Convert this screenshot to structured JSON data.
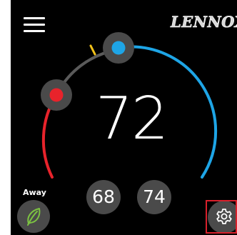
{
  "header": {
    "brand": "LENNOX",
    "menu_icon": "hamburger-menu-icon"
  },
  "thermostat": {
    "current_temperature": "72",
    "heat_setpoint": "68",
    "cool_setpoint": "74",
    "colors": {
      "heat": "#e8232b",
      "cool": "#1ea5e6",
      "track": "#5a5a5a",
      "outdoor_marker": "#f3c21a",
      "button_bg": "#4a4a4a"
    }
  },
  "away": {
    "label": "Away",
    "icon": "leaf-icon",
    "icon_color": "#7cc242"
  },
  "settings": {
    "icon": "gear-icon",
    "highlight_color": "#d8202b"
  }
}
